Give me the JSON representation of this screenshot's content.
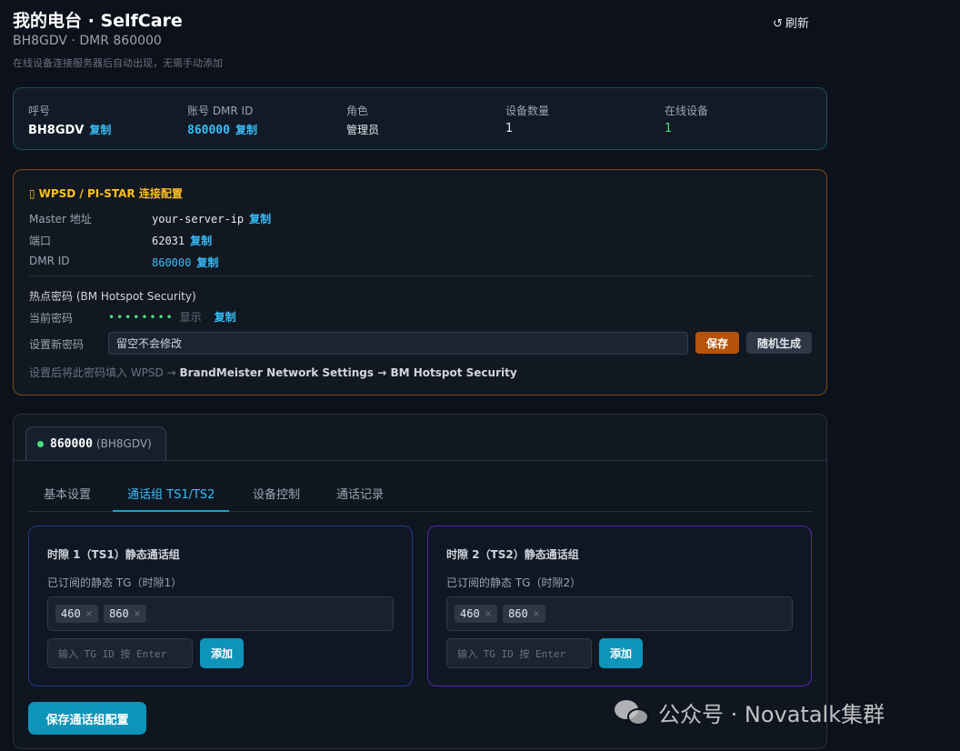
{
  "header": {
    "title": "我的电台 · SelfCare",
    "subtitle": "BH8GDV · DMR 860000",
    "hint": "在线设备连接服务器后自动出现，无需手动添加",
    "refresh_label": "刷新",
    "refresh_icon": "↺"
  },
  "summary": {
    "callsign_label": "呼号",
    "callsign": "BH8GDV",
    "dmr_label": "账号 DMR ID",
    "dmr_id": "860000",
    "role_label": "角色",
    "role": "管理员",
    "device_count_label": "设备数量",
    "device_count": "1",
    "online_label": "在线设备",
    "online": "1",
    "copy_label": "复制"
  },
  "wpsd": {
    "icon": "▯",
    "title": "WPSD / PI-STAR 连接配置",
    "master_label": "Master 地址",
    "master_value": "your-server-ip",
    "port_label": "端口",
    "port_value": "62031",
    "dmr_label": "DMR ID",
    "dmr_value": "860000",
    "copy_label": "复制",
    "security_title": "热点密码 (BM Hotspot Security)",
    "current_pwd_label": "当前密码",
    "current_pwd_mask": "••••••••",
    "show_label": "显示",
    "new_pwd_label": "设置新密码",
    "new_pwd_placeholder": "留空不会修改",
    "save_label": "保存",
    "random_label": "随机生成",
    "instruction_prefix": "设置后将此密码填入 WPSD → ",
    "instruction_path": "BrandMeister Network Settings → BM Hotspot Security"
  },
  "device": {
    "id": "860000",
    "callsign": "(BH8GDV)",
    "tabs": [
      "基本设置",
      "通话组 TS1/TS2",
      "设备控制",
      "通话记录"
    ],
    "ts1": {
      "title": "时隙 1（TS1）静态通话组",
      "sub": "已订阅的静态 TG（时隙1）",
      "tgs": [
        "460",
        "860"
      ],
      "input_placeholder": "输入 TG ID 按 Enter",
      "add_label": "添加"
    },
    "ts2": {
      "title": "时隙 2（TS2）静态通话组",
      "sub": "已订阅的静态 TG（时隙2）",
      "tgs": [
        "460",
        "860"
      ],
      "input_placeholder": "输入 TG ID 按 Enter",
      "add_label": "添加"
    },
    "save_tg_label": "保存通话组配置"
  },
  "watermark": "公众号 · Novatalk集群",
  "colors": {
    "accent": "#38bdf8",
    "online": "#4ade80",
    "warning": "#fbbf24",
    "save_button": "#b45309",
    "primary_button": "#0e94b8"
  }
}
